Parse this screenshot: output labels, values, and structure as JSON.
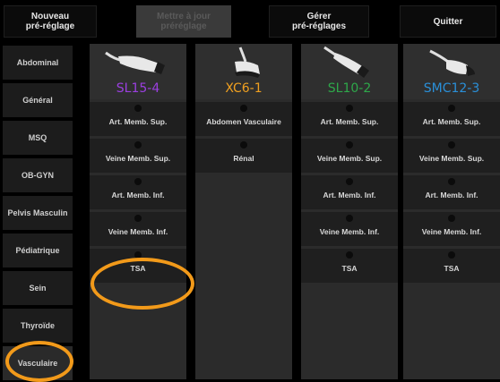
{
  "toolbar": {
    "new_preset": "Nouveau\npré-réglage",
    "update_preset": "Mettre à jour\npréréglage",
    "manage_presets": "Gérer\npré-réglages",
    "quit": "Quitter"
  },
  "categories": [
    {
      "label": "Abdominal"
    },
    {
      "label": "Général"
    },
    {
      "label": "MSQ"
    },
    {
      "label": "OB-GYN"
    },
    {
      "label": "Pelvis Masculin"
    },
    {
      "label": "Pédiatrique"
    },
    {
      "label": "Sein"
    },
    {
      "label": "Thyroïde"
    },
    {
      "label": "Vasculaire",
      "selected": true
    }
  ],
  "probes": [
    {
      "name": "SL15-4",
      "color": "#9b3fe0",
      "icon": "linear-probe-icon",
      "presets": [
        "Art. Memb. Sup.",
        "Veine Memb. Sup.",
        "Art. Memb. Inf.",
        "Veine Memb. Inf.",
        "TSA"
      ]
    },
    {
      "name": "XC6-1",
      "color": "#f0a020",
      "icon": "convex-probe-icon",
      "presets": [
        "Abdomen Vasculaire",
        "Rénal"
      ]
    },
    {
      "name": "SL10-2",
      "color": "#2ea84a",
      "icon": "linear-probe-icon",
      "presets": [
        "Art. Memb. Sup.",
        "Veine Memb. Sup.",
        "Art. Memb. Inf.",
        "Veine Memb. Inf.",
        "TSA"
      ]
    },
    {
      "name": "SMC12-3",
      "color": "#2a8fd8",
      "icon": "microconvex-probe-icon",
      "presets": [
        "Art. Memb. Sup.",
        "Veine Memb. Sup.",
        "Art. Memb. Inf.",
        "Veine Memb. Inf.",
        "TSA"
      ]
    }
  ],
  "highlight_color": "#f29a1a"
}
